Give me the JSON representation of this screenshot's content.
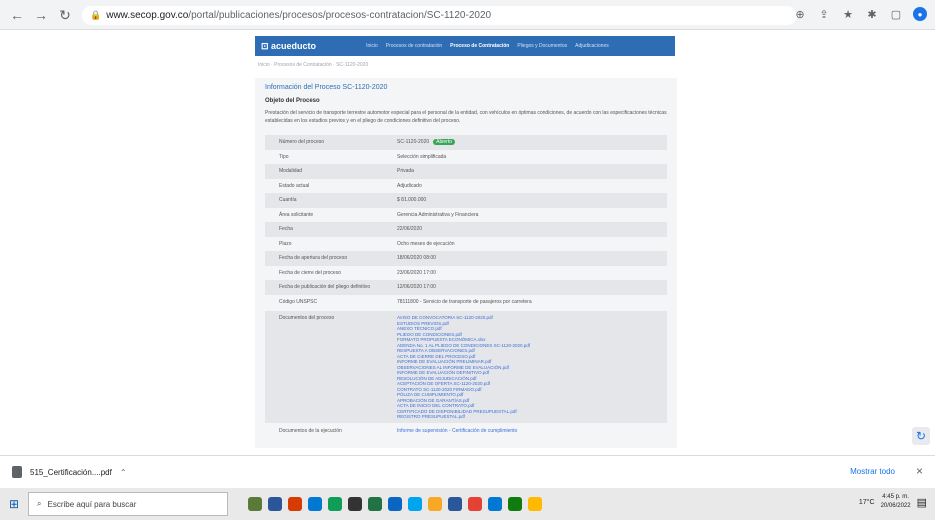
{
  "browser": {
    "back_icon": "←",
    "forward_icon": "→",
    "reload_icon": "↻",
    "lock_icon": "🔒",
    "url_domain": "www.secop.gov.co",
    "url_path": "/portal/publicaciones/procesos/procesos-contratacion/SC-1120-2020",
    "zoom_icon": "⊕",
    "share_icon": "⇪",
    "star_icon": "★",
    "ext_icon": "✱",
    "window_icon": "▢",
    "profile_icon": "●"
  },
  "site": {
    "logo": "⊡ acueducto",
    "nav": [
      "Inicio",
      "Procesos de contratación",
      "Proceso de Contratación",
      "Pliegos y Documentos",
      "Adjudicaciones"
    ]
  },
  "breadcrumb": "Inicio · Procesos de Contratación · SC-1120-2020",
  "process": {
    "title": "Información del Proceso SC-1120-2020",
    "section": "Objeto del Proceso",
    "description": "Prestación del servicio de transporte terrestre automotor especial para el personal de la entidad, con vehículos en óptimas condiciones, de acuerdo con las especificaciones técnicas establecidas en los estudios previos y en el pliego de condiciones definitivo del proceso.",
    "fields": [
      {
        "label": "Número del proceso",
        "value": "SC-1120-2020",
        "badge": "Abierto"
      },
      {
        "label": "Tipo",
        "value": "Selección simplificada",
        "badge": ""
      },
      {
        "label": "Modalidad",
        "value": "Privada",
        "badge": ""
      },
      {
        "label": "Estado actual",
        "value": "Adjudicado",
        "badge": ""
      },
      {
        "label": "Cuantía",
        "value": "$ 81.000.000",
        "badge": ""
      },
      {
        "label": "Área solicitante",
        "value": "Gerencia Administrativa y Financiera",
        "badge": ""
      },
      {
        "label": "Fecha",
        "value": "22/06/2020",
        "badge": ""
      },
      {
        "label": "Plazo",
        "value": "Ocho meses de ejecución",
        "badge": ""
      },
      {
        "label": "Fecha de apertura del proceso",
        "value": "18/06/2020 08:00",
        "badge": ""
      },
      {
        "label": "Fecha de cierre del proceso",
        "value": "23/06/2020 17:00",
        "badge": ""
      },
      {
        "label": "Fecha de publicación del pliego definitivo",
        "value": "12/06/2020 17:00",
        "badge": ""
      },
      {
        "label": "Código UNSPSC",
        "value": "78111800 - Servicio de transporte de pasajeros por carretera",
        "badge": ""
      }
    ],
    "documents_label": "Documentos del proceso",
    "documents": [
      "AVISO DE CONVOCATORIA SC-1120-2020.pdf",
      "ESTUDIOS PREVIOS.pdf",
      "ANEXO TÉCNICO.pdf",
      "PLIEGO DE CONDICIONES.pdf",
      "FORMATO PROPUESTA ECONÓMICA.xlsx",
      "ADENDA No. 1 AL PLIEGO DE CONDICIONES SC-1120-2020.pdf",
      "RESPUESTA A OBSERVACIONES.pdf",
      "ACTA DE CIERRE DEL PROCESO.pdf",
      "INFORME DE EVALUACIÓN PRELIMINAR.pdf",
      "OBSERVACIONES AL INFORME DE EVALUACIÓN.pdf",
      "INFORME DE EVALUACIÓN DEFINITIVO.pdf",
      "RESOLUCIÓN DE ADJUDICACIÓN.pdf",
      "ACEPTACIÓN DE OFERTA SC-1120-2020.pdf",
      "CONTRATO SC-1120-2020 FIRMADO.pdf",
      "PÓLIZA DE CUMPLIMIENTO.pdf",
      "APROBACIÓN DE GARANTÍAS.pdf",
      "ACTA DE INICIO DEL CONTRATO.pdf",
      "CERTIFICADO DE DISPONIBILIDAD PRESUPUESTAL.pdf",
      "REGISTRO PRESUPUESTAL.pdf"
    ],
    "bottom_label": "Documentos de la ejecución",
    "bottom_value": "Informe de supervisión - Certificación de cumplimiento"
  },
  "scroll_button_icon": "↻",
  "downloads": {
    "file_name": "515_Certificación....pdf",
    "chevron": "⌃",
    "show_all": "Mostrar todo",
    "close_icon": "×"
  },
  "taskbar": {
    "start_icon": "⊞",
    "search_icon": "⌕",
    "search_placeholder": "Escribe aquí para buscar",
    "temperature": "17°C",
    "time": "4:45 p. m.",
    "date": "20/06/2022",
    "notif_icon": "▤",
    "app_colors": [
      "#5a7a3a",
      "#2b579a",
      "#d83b01",
      "#0078d4",
      "#0f9d58",
      "#333333",
      "#217346",
      "#0a66c2",
      "#00a4ef",
      "#f9a825",
      "#2b579a",
      "#e34234",
      "#0078d4",
      "#107c10",
      "#ffb900"
    ]
  }
}
